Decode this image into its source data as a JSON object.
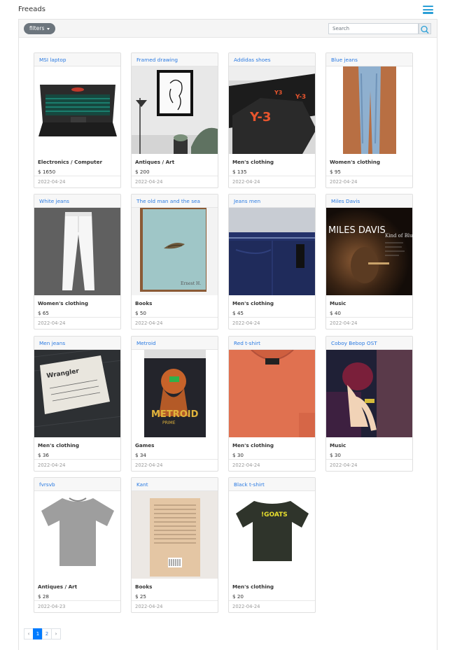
{
  "app": {
    "title": "Freeads"
  },
  "toolbar": {
    "filters_label": "filters",
    "search_placeholder": "Search"
  },
  "colors": {
    "accent": "#2a9fd6",
    "link": "#2a7ae2",
    "button_gray": "#6c757d",
    "page_active": "#007bff"
  },
  "ads": [
    {
      "title": "MSI laptop",
      "category": "Electronics / Computer",
      "price": "$ 1650",
      "date": "2022-04-24",
      "image": "laptop"
    },
    {
      "title": "Framed drawing",
      "category": "Antiques / Art",
      "price": "$ 200",
      "date": "2022-04-24",
      "image": "drawing"
    },
    {
      "title": "Addidas shoes",
      "category": "Men's clothing",
      "price": "$ 135",
      "date": "2022-04-24",
      "image": "shoes"
    },
    {
      "title": "Blue jeans",
      "category": "Women's clothing",
      "price": "$ 95",
      "date": "2022-04-24",
      "image": "bluejeans"
    },
    {
      "title": "White jeans",
      "category": "Women's clothing",
      "price": "$ 65",
      "date": "2022-04-24",
      "image": "whitejeans"
    },
    {
      "title": "The old man and the sea",
      "category": "Books",
      "price": "$ 50",
      "date": "2022-04-24",
      "image": "book"
    },
    {
      "title": "Jeans men",
      "category": "Men's clothing",
      "price": "$ 45",
      "date": "2022-04-24",
      "image": "navyjeans"
    },
    {
      "title": "Miles Davis",
      "category": "Music",
      "price": "$ 40",
      "date": "2022-04-24",
      "image": "record",
      "image_text": "MILES DAVIS",
      "image_subtext": "Kind of Blue"
    },
    {
      "title": "Men jeans",
      "category": "Men's clothing",
      "price": "$ 36",
      "date": "2022-04-24",
      "image": "denimlabel",
      "image_text": "Wrangler"
    },
    {
      "title": "Metroid",
      "category": "Games",
      "price": "$ 34",
      "date": "2022-04-24",
      "image": "game",
      "image_text": "METROID",
      "image_subtext": "PRIME"
    },
    {
      "title": "Red t-shirt",
      "category": "Men's clothing",
      "price": "$ 30",
      "date": "2022-04-24",
      "image": "redshirt"
    },
    {
      "title": "Coboy Bebop OST",
      "category": "Music",
      "price": "$ 30",
      "date": "2022-04-24",
      "image": "anime"
    },
    {
      "title": "fvrsvb",
      "category": "Antiques / Art",
      "price": "$ 28",
      "date": "2022-04-23",
      "image": "grayshirt"
    },
    {
      "title": "Kant",
      "category": "Books",
      "price": "$ 25",
      "date": "2022-04-24",
      "image": "bookback"
    },
    {
      "title": "Black t-shirt",
      "category": "Men's clothing",
      "price": "$ 20",
      "date": "2022-04-24",
      "image": "blackshirt",
      "image_text": "!GOATS"
    }
  ],
  "pagination": {
    "prev": "‹",
    "pages": [
      "1",
      "2"
    ],
    "active_page": "1",
    "next": "›"
  }
}
